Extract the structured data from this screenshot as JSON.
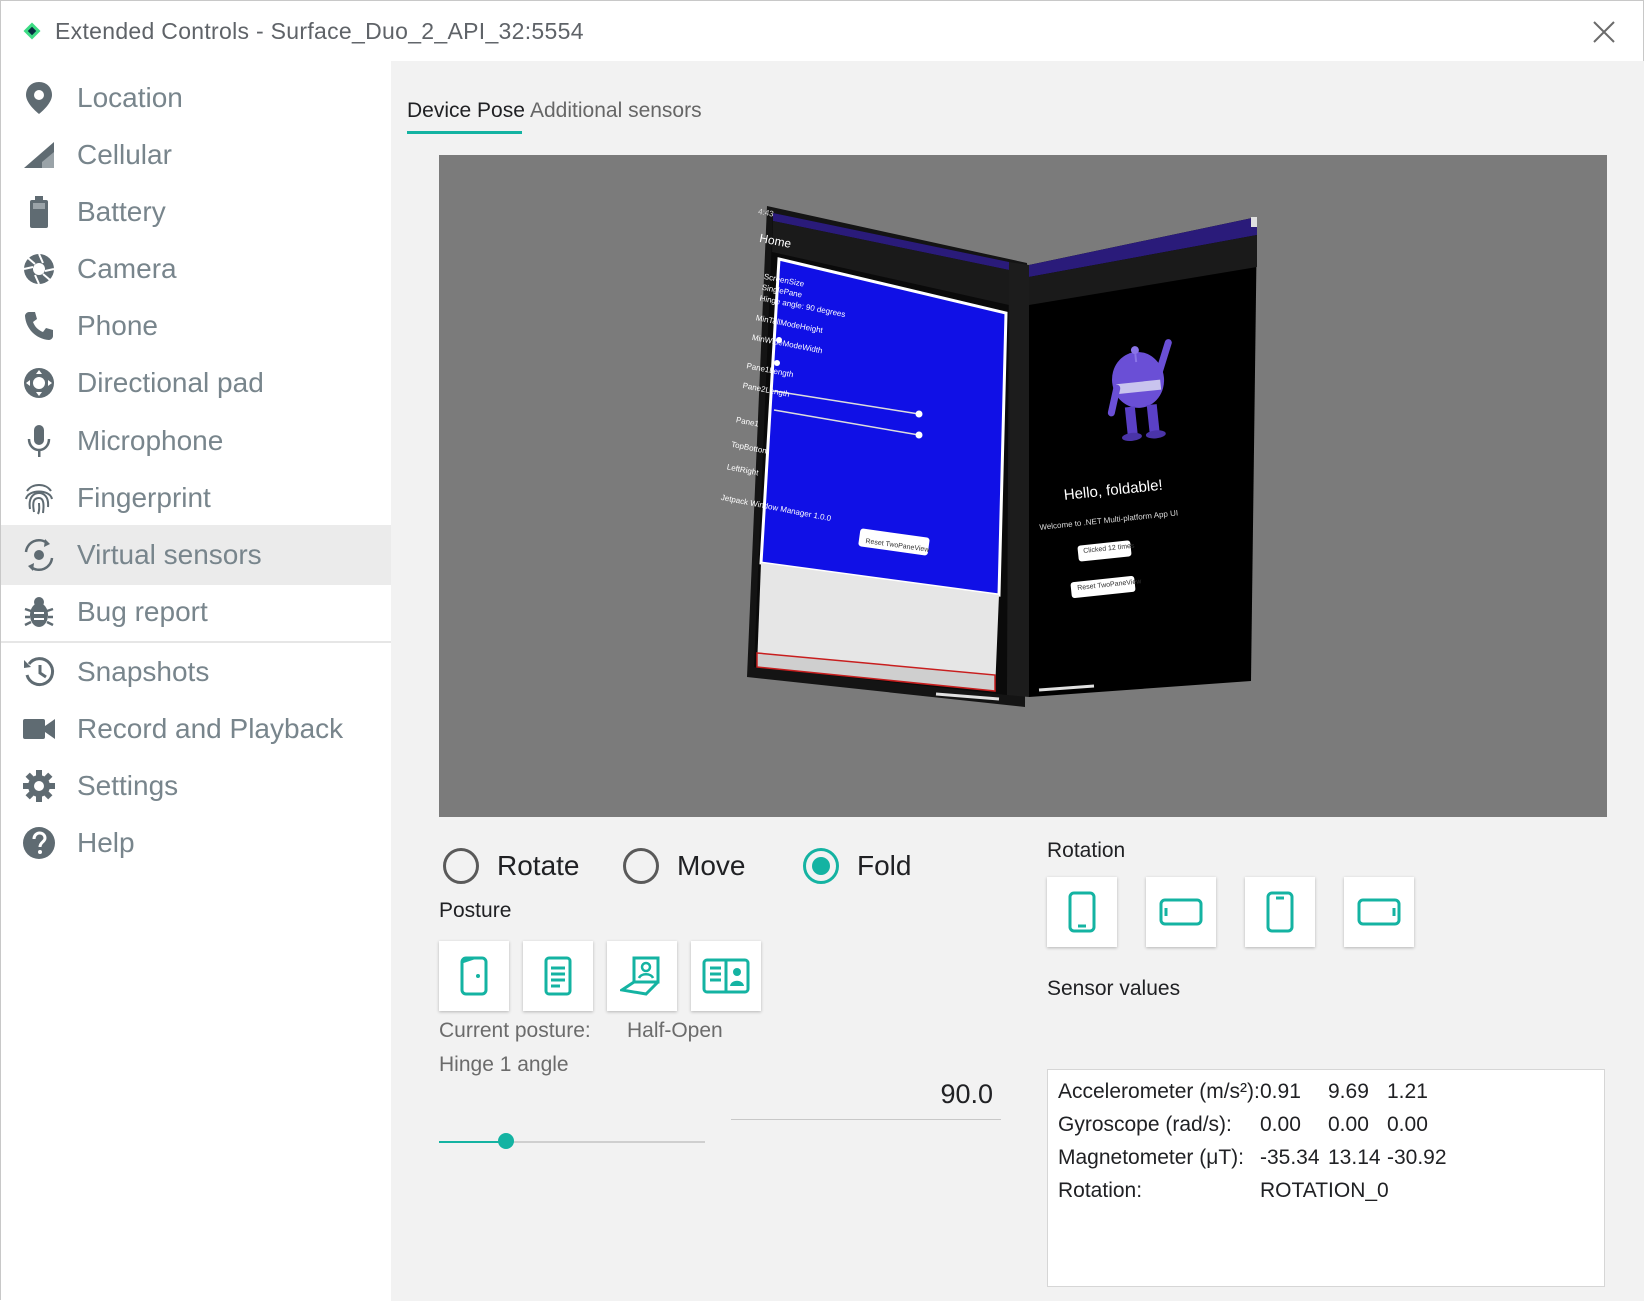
{
  "window": {
    "title": "Extended Controls - Surface_Duo_2_API_32:5554"
  },
  "sidebar": {
    "items": [
      {
        "label": "Location",
        "icon": "location-pin-icon"
      },
      {
        "label": "Cellular",
        "icon": "cellular-signal-icon"
      },
      {
        "label": "Battery",
        "icon": "battery-icon"
      },
      {
        "label": "Camera",
        "icon": "camera-aperture-icon"
      },
      {
        "label": "Phone",
        "icon": "phone-icon"
      },
      {
        "label": "Directional pad",
        "icon": "dpad-icon"
      },
      {
        "label": "Microphone",
        "icon": "microphone-icon"
      },
      {
        "label": "Fingerprint",
        "icon": "fingerprint-icon"
      },
      {
        "label": "Virtual sensors",
        "icon": "rotation-sensor-icon",
        "active": true
      },
      {
        "label": "Bug report",
        "icon": "bug-icon"
      },
      {
        "label": "Snapshots",
        "icon": "history-icon"
      },
      {
        "label": "Record and Playback",
        "icon": "video-camera-icon"
      },
      {
        "label": "Settings",
        "icon": "gear-icon"
      },
      {
        "label": "Help",
        "icon": "help-icon"
      }
    ]
  },
  "tabs": {
    "active": "Device Pose",
    "inactive": "Additional sensors"
  },
  "device_screen": {
    "left": {
      "time": "4:43",
      "app_title": "Home",
      "lines": [
        "ScreenSize",
        "SinglePane",
        "Hinge angle: 90 degrees",
        "MinTallModeHeight",
        "MinWideModeWidth",
        "Pane1Length",
        "Pane2Length",
        "Pane1",
        "TopBottom",
        "LeftRight",
        "Jetpack Window Manager 1.0.0"
      ],
      "button": "Reset TwoPaneView"
    },
    "right": {
      "heading": "Hello, foldable!",
      "subtitle": "Welcome to .NET Multi-platform App UI",
      "button1": "Clicked 12 times",
      "button2": "Reset TwoPaneView"
    }
  },
  "mode": {
    "rotate": "Rotate",
    "move": "Move",
    "fold": "Fold",
    "selected": "Fold"
  },
  "posture": {
    "label": "Posture",
    "current_label": "Current posture:",
    "current_value": "Half-Open",
    "buttons": [
      "posture-closed-icon",
      "posture-book-icon",
      "posture-laptop-icon",
      "posture-open-icon"
    ]
  },
  "hinge": {
    "label": "Hinge 1 angle",
    "value": "90.0",
    "fraction": 0.25
  },
  "rotation": {
    "label": "Rotation",
    "buttons": [
      "portrait-icon",
      "landscape-icon",
      "reverse-portrait-icon",
      "reverse-landscape-icon"
    ]
  },
  "sensors": {
    "label": "Sensor values",
    "rows": [
      {
        "name": "Accelerometer (m/s²):",
        "v1": "0.91",
        "v2": "9.69",
        "v3": "1.21"
      },
      {
        "name": "Gyroscope (rad/s):",
        "v1": "0.00",
        "v2": "0.00",
        "v3": "0.00"
      },
      {
        "name": "Magnetometer (μT):",
        "v1": "-35.34",
        "v2": "13.14",
        "v3": "-30.92"
      },
      {
        "name": "Rotation:",
        "v1": "ROTATION_0",
        "v2": "",
        "v3": ""
      }
    ]
  },
  "colors": {
    "accent": "#14b3a2",
    "sidebar_icon": "#5f6b72",
    "sidebar_text": "#78858c",
    "viewport_bg": "#7b7b7b"
  }
}
